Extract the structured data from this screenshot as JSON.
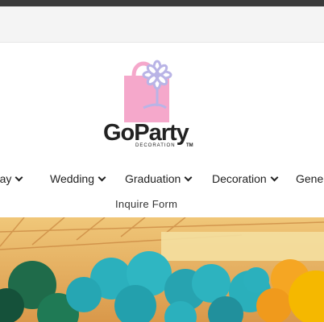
{
  "brand": {
    "name": "GoParty",
    "subtitle": "DECORATION",
    "trademark": "TM",
    "bag_color": "#f5a8cb",
    "ribbon_color": "#b9b4e6"
  },
  "nav": {
    "items": [
      {
        "label": "nday"
      },
      {
        "label": "Wedding"
      },
      {
        "label": "Graduation"
      },
      {
        "label": "Decoration"
      },
      {
        "label": "Gener"
      }
    ],
    "secondary": "Inquire Form"
  },
  "colors": {
    "topbar": "#3a3a3a",
    "announce_bg": "#f4f4f4",
    "hero_wood": "#e9b864",
    "balloon_teal": "#2bb0bd",
    "balloon_green": "#1f6b4a",
    "balloon_yellow": "#f5b800"
  }
}
